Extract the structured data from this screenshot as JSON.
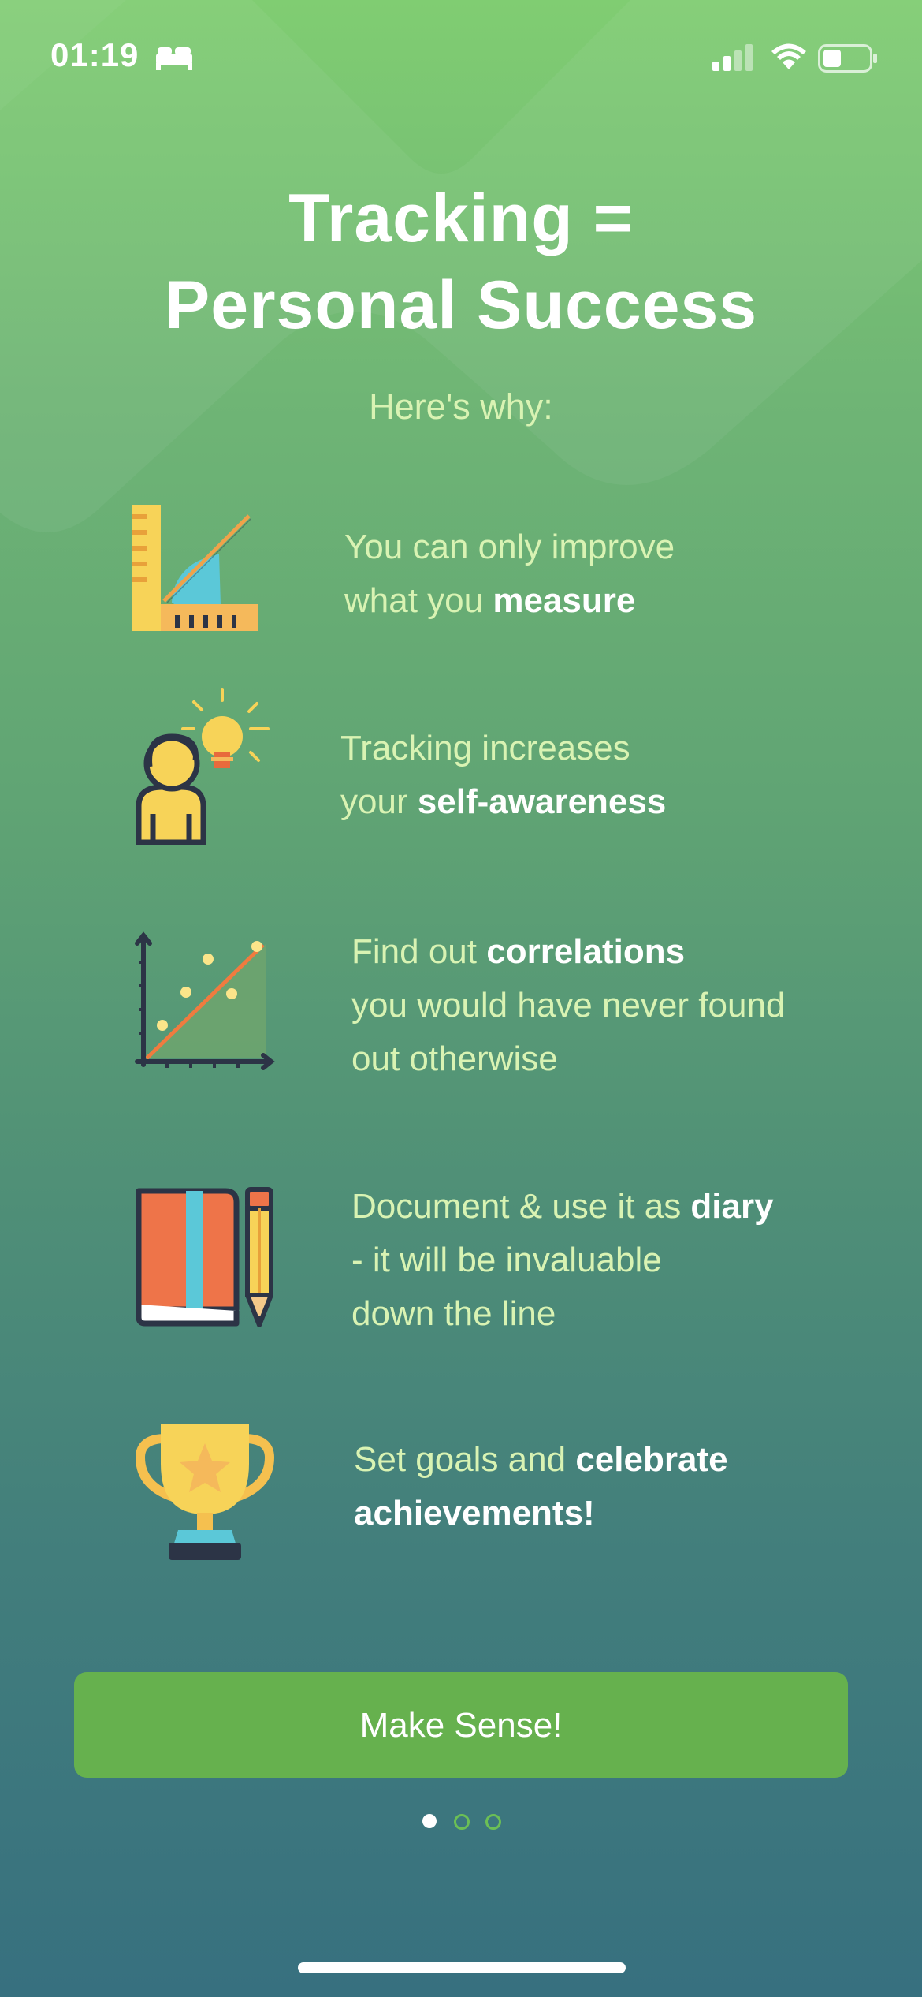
{
  "status_bar": {
    "time": "01:19"
  },
  "title_line1": "Tracking =",
  "title_line2": "Personal Success",
  "subtitle": "Here's why:",
  "reasons": [
    {
      "icon": "ruler-protractor-icon",
      "l1": "You can only improve",
      "l2a": "what you ",
      "l2b": "measure"
    },
    {
      "icon": "person-lightbulb-icon",
      "l1": "Tracking increases",
      "l2a": "your ",
      "l2b": "self-awareness"
    },
    {
      "icon": "scatter-chart-icon",
      "l1a": "Find out ",
      "l1b": "correlations",
      "l2": "you would have never found",
      "l3": "out otherwise"
    },
    {
      "icon": "notebook-pencil-icon",
      "l1a": "Document & use it as ",
      "l1b": "diary",
      "l2": "- it will be invaluable",
      "l3": "down the line"
    },
    {
      "icon": "trophy-icon",
      "l1a": "Set goals and ",
      "l1b": "celebrate",
      "l2b": "achievements!"
    }
  ],
  "button_label": "Make Sense!",
  "pagination": {
    "current": 1,
    "total": 3
  },
  "colors": {
    "accent": "#66b14e",
    "text_light": "#d9f3b3"
  }
}
